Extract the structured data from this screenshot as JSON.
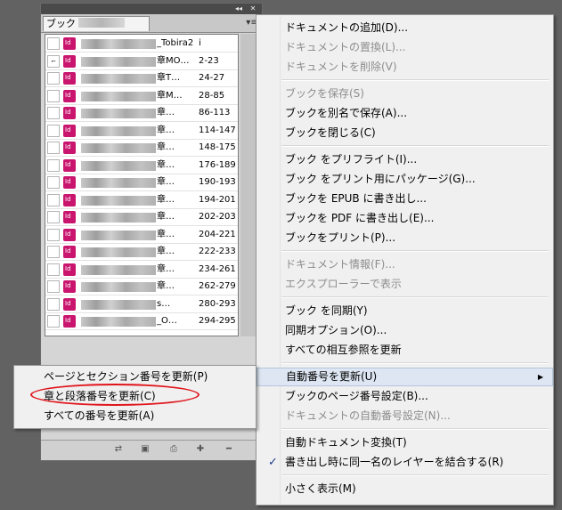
{
  "panel": {
    "tab_label": "ブック",
    "collapse_label": "◂◂",
    "close_label": "✕",
    "menu_label": "▾≡",
    "documents": [
      {
        "name": "_Tobira2",
        "pages": "i",
        "status": ""
      },
      {
        "name": "章MO…",
        "pages": "2-23",
        "status": "link"
      },
      {
        "name": "章T…",
        "pages": "24-27",
        "status": ""
      },
      {
        "name": "章M…",
        "pages": "28-85",
        "status": ""
      },
      {
        "name": "章…",
        "pages": "86-113",
        "status": ""
      },
      {
        "name": "章…",
        "pages": "114-147",
        "status": ""
      },
      {
        "name": "章…",
        "pages": "148-175",
        "status": ""
      },
      {
        "name": "章…",
        "pages": "176-189",
        "status": ""
      },
      {
        "name": "章…",
        "pages": "190-193",
        "status": ""
      },
      {
        "name": "章…",
        "pages": "194-201",
        "status": ""
      },
      {
        "name": "章…",
        "pages": "202-203",
        "status": ""
      },
      {
        "name": "章…",
        "pages": "204-221",
        "status": ""
      },
      {
        "name": "章…",
        "pages": "222-233",
        "status": ""
      },
      {
        "name": "章…",
        "pages": "234-261",
        "status": ""
      },
      {
        "name": "章…",
        "pages": "262-279",
        "status": ""
      },
      {
        "name": "s…",
        "pages": "280-293",
        "status": ""
      },
      {
        "name": "_O…",
        "pages": "294-295",
        "status": ""
      }
    ],
    "bottom_buttons": [
      "sync-icon",
      "save-icon",
      "print-icon",
      "add-icon",
      "remove-icon"
    ]
  },
  "menu": {
    "items": [
      {
        "label": "ドキュメントの追加(D)...",
        "enabled": true
      },
      {
        "label": "ドキュメントの置換(L)...",
        "enabled": false
      },
      {
        "label": "ドキュメントを削除(V)",
        "enabled": false
      },
      {
        "label": "ブックを保存(S)",
        "enabled": false
      },
      {
        "label": "ブックを別名で保存(A)...",
        "enabled": true
      },
      {
        "label": "ブックを閉じる(C)",
        "enabled": true
      },
      {
        "label": "ブック をプリフライト(I)...",
        "enabled": true
      },
      {
        "label": "ブック をプリント用にパッケージ(G)...",
        "enabled": true
      },
      {
        "label": "ブックを EPUB に書き出し...",
        "enabled": true
      },
      {
        "label": "ブックを PDF に書き出し(E)...",
        "enabled": true
      },
      {
        "label": "ブックをプリント(P)...",
        "enabled": true
      },
      {
        "label": "ドキュメント情報(F)...",
        "enabled": false
      },
      {
        "label": "エクスプローラーで表示",
        "enabled": false
      },
      {
        "label": "ブック を同期(Y)",
        "enabled": true
      },
      {
        "label": "同期オプション(O)...",
        "enabled": true
      },
      {
        "label": "すべての相互参照を更新",
        "enabled": true
      },
      {
        "label": "自動番号を更新(U)",
        "enabled": true,
        "highlighted": true,
        "submenu": true
      },
      {
        "label": "ブックのページ番号設定(B)...",
        "enabled": true
      },
      {
        "label": "ドキュメントの自動番号設定(N)...",
        "enabled": false
      },
      {
        "label": "自動ドキュメント変換(T)",
        "enabled": true
      },
      {
        "label": "書き出し時に同一名のレイヤーを結合する(R)",
        "enabled": true,
        "checked": true
      },
      {
        "label": "小さく表示(M)",
        "enabled": true
      }
    ],
    "check_glyph": "✓",
    "submenu_arrow": "▶"
  },
  "submenu": {
    "items": [
      {
        "label": "ページとセクション番号を更新(P)"
      },
      {
        "label": "章と段落番号を更新(C)",
        "circled": true
      },
      {
        "label": "すべての番号を更新(A)"
      }
    ],
    "circle_color": "#e0151c"
  },
  "colors": {
    "background": "#626262",
    "indesign_icon": "#c9156e",
    "highlight": "#dde6f2"
  }
}
